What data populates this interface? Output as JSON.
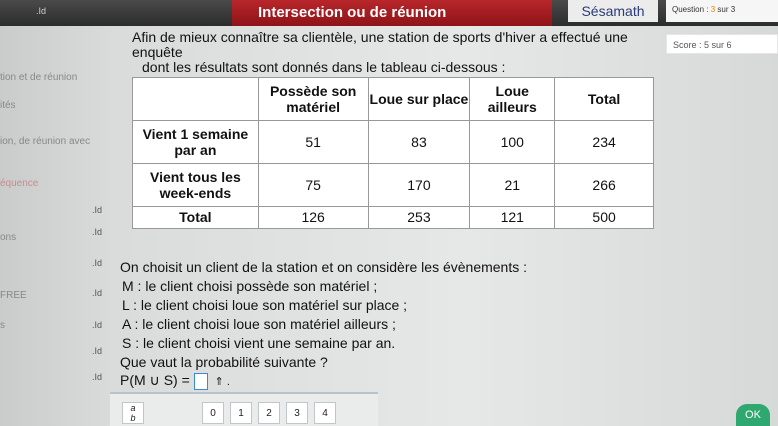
{
  "header": {
    "tag": ".Id",
    "title": "Intersection ou de réunion",
    "brand": "Sésamath",
    "question_label": "Question :",
    "question_current": "3",
    "question_suffix": "sur 3",
    "score": "Score : 5 sur 6"
  },
  "sidebar": {
    "items": [
      {
        "label": "tion et de réunion",
        "tone": "grey"
      },
      {
        "label": "ités",
        "tone": "grey"
      },
      {
        "label": "ion, de réunion avec",
        "tone": "grey"
      },
      {
        "label": "équence",
        "tone": "red"
      },
      {
        "label": "ons",
        "tone": "grey"
      },
      {
        "label": "FREE",
        "tone": "grey"
      },
      {
        "label": "s",
        "tone": "grey"
      }
    ]
  },
  "exercise": {
    "intro_line1": "Afin de mieux connaître sa clientèle, une station de sports d'hiver a effectué une enquête",
    "intro_line2": "dont les résultats sont donnés dans le tableau ci-dessous :",
    "table": {
      "headers": [
        "",
        "Possède son matériel",
        "Loue sur place",
        "Loue ailleurs",
        "Total"
      ],
      "rows": [
        [
          "Vient 1 semaine par an",
          "51",
          "83",
          "100",
          "234"
        ],
        [
          "Vient tous les week-ends",
          "75",
          "170",
          "21",
          "266"
        ],
        [
          "Total",
          "126",
          "253",
          "121",
          "500"
        ]
      ]
    },
    "events_intro": "On choisit un client de la station et on considère les évènements :",
    "events": [
      "M : le client choisi possède son matériel ;",
      "L : le client choisi loue son matériel sur place ;",
      "A : le client choisi loue son matériel ailleurs ;",
      "S : le client choisi vient une semaine par an."
    ],
    "question": "Que vaut la probabilité suivante ?",
    "formula": "P(M ∪ S) =",
    "submit_glyph": "⇑ ."
  },
  "keypad": {
    "fraction_num": "a",
    "fraction_den": "b",
    "keys": [
      "0",
      "1",
      "2",
      "3",
      "4"
    ]
  },
  "ok_label": "OK",
  "colors": {
    "red_tab": "#b8262a",
    "brand_text": "#2a3c77",
    "ok": "#2ea86e",
    "input_border": "#3a8ad6"
  }
}
